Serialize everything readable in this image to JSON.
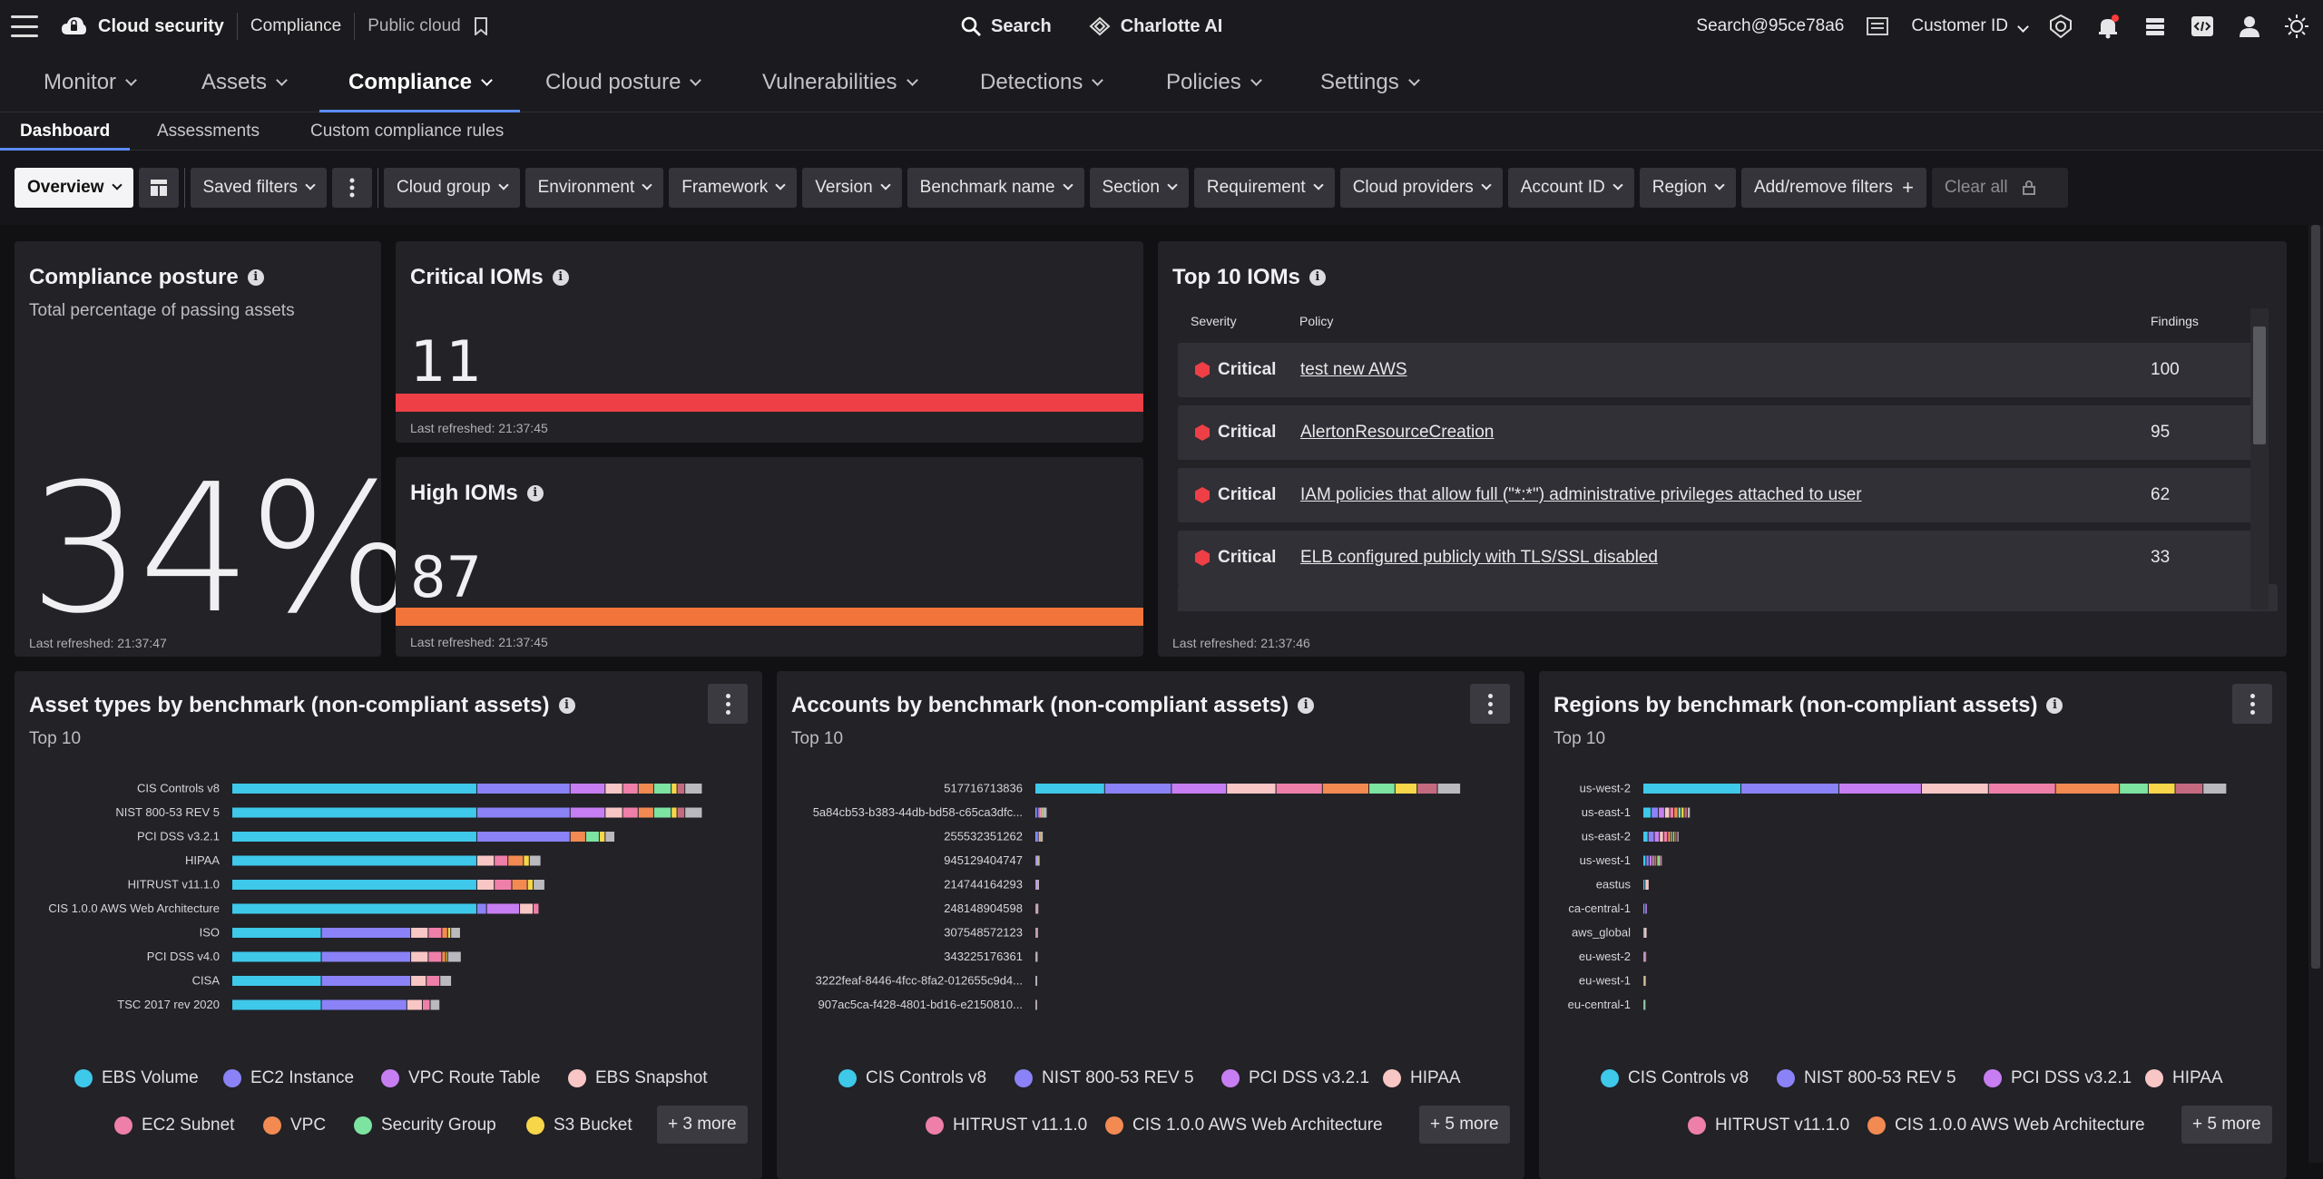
{
  "topbar": {
    "brand": "Cloud security",
    "crumbs": [
      "Compliance",
      "Public cloud"
    ],
    "search_label": "Search",
    "ai_label": "Charlotte AI",
    "user": "Search@95ce78a6",
    "customer_label": "Customer ID"
  },
  "nav": {
    "items": [
      {
        "label": "Monitor"
      },
      {
        "label": "Assets"
      },
      {
        "label": "Compliance"
      },
      {
        "label": "Cloud posture"
      },
      {
        "label": "Vulnerabilities"
      },
      {
        "label": "Detections"
      },
      {
        "label": "Policies"
      },
      {
        "label": "Settings"
      }
    ],
    "active": "Compliance"
  },
  "subnav": {
    "items": [
      {
        "label": "Dashboard"
      },
      {
        "label": "Assessments"
      },
      {
        "label": "Custom compliance rules"
      }
    ],
    "active": "Dashboard"
  },
  "filters": {
    "view": "Overview",
    "saved": "Saved filters",
    "items": [
      "Cloud group",
      "Environment",
      "Framework",
      "Version",
      "Benchmark name",
      "Section",
      "Requirement",
      "Cloud providers",
      "Account ID",
      "Region"
    ],
    "add": "Add/remove filters",
    "clear": "Clear all"
  },
  "posture": {
    "title": "Compliance posture",
    "subtitle": "Total percentage of passing assets",
    "value": "34%",
    "refreshed": "Last refreshed: 21:37:47"
  },
  "critical": {
    "title": "Critical IOMs",
    "value": "11",
    "color": "#ee3f46",
    "refreshed": "Last refreshed: 21:37:45"
  },
  "high": {
    "title": "High IOMs",
    "value": "87",
    "color": "#f2743a",
    "refreshed": "Last refreshed: 21:37:45"
  },
  "top10": {
    "title": "Top 10 IOMs",
    "headers": {
      "severity": "Severity",
      "policy": "Policy",
      "findings": "Findings"
    },
    "rows": [
      {
        "severity": "Critical",
        "policy": "test new AWS",
        "findings": "100"
      },
      {
        "severity": "Critical",
        "policy": "AlertonResourceCreation",
        "findings": "95"
      },
      {
        "severity": "Critical",
        "policy": "IAM policies that allow full (\"*:*\") administrative privileges attached to user",
        "findings": "62"
      },
      {
        "severity": "Critical",
        "policy": "ELB configured publicly with TLS/SSL disabled",
        "findings": "33"
      }
    ],
    "refreshed": "Last refreshed: 21:37:46"
  },
  "asset_chart": {
    "title": "Asset types by benchmark (non-compliant assets)",
    "subtitle": "Top 10",
    "legend": [
      "EBS Volume",
      "EC2 Instance",
      "VPC Route Table",
      "EBS Snapshot",
      "EC2 Subnet",
      "VPC",
      "Security Group",
      "S3 Bucket"
    ],
    "legend_colors": [
      "#3ec8ea",
      "#8a82f6",
      "#c77ef2",
      "#f8c6c4",
      "#ee7fa8",
      "#f28a52",
      "#7ce3a0",
      "#f7d64a"
    ],
    "more": "+ 3 more"
  },
  "accounts_chart": {
    "title": "Accounts by benchmark (non-compliant assets)",
    "subtitle": "Top 10",
    "legend": [
      "CIS Controls v8",
      "NIST 800-53 REV 5",
      "PCI DSS v3.2.1",
      "HIPAA",
      "HITRUST v11.1.0",
      "CIS 1.0.0 AWS Web Architecture"
    ],
    "legend_colors": [
      "#3ec8ea",
      "#8a82f6",
      "#c77ef2",
      "#f8c6c4",
      "#ee7fa8",
      "#f28a52"
    ],
    "more": "+ 5 more"
  },
  "regions_chart": {
    "title": "Regions by benchmark (non-compliant assets)",
    "subtitle": "Top 10",
    "legend": [
      "CIS Controls v8",
      "NIST 800-53 REV 5",
      "PCI DSS v3.2.1",
      "HIPAA",
      "HITRUST v11.1.0",
      "CIS 1.0.0 AWS Web Architecture"
    ],
    "legend_colors": [
      "#3ec8ea",
      "#8a82f6",
      "#c77ef2",
      "#f8c6c4",
      "#ee7fa8",
      "#f28a52"
    ],
    "more": "+ 5 more"
  },
  "chart_data": [
    {
      "type": "bar",
      "orientation": "horizontal",
      "stacked": true,
      "xlim": [
        0,
        13000
      ],
      "ticks": [
        0,
        1000,
        2000,
        3000,
        4000,
        5000,
        6000,
        7000,
        8000,
        9000,
        10000,
        11000,
        12000,
        13000
      ],
      "categories": [
        "CIS Controls v8",
        "NIST 800-53 REV 5",
        "PCI DSS v3.2.1",
        "HIPAA",
        "HITRUST v11.1.0",
        "CIS 1.0.0 AWS Web Architecture",
        "ISO",
        "PCI DSS v4.0",
        "CISA",
        "TSC 2017 rev 2020"
      ],
      "colors": [
        "#3ec8ea",
        "#8a82f6",
        "#c77ef2",
        "#f8c6c4",
        "#ee7fa8",
        "#f28a52",
        "#7ce3a0",
        "#f7d64a",
        "#c46a80",
        "#b9b9be"
      ],
      "series": [
        {
          "values": [
            6300,
            6300,
            6300,
            6300,
            6300,
            6300,
            2300,
            2300,
            2300,
            2300
          ]
        },
        {
          "values": [
            2400,
            2400,
            2400,
            0,
            0,
            250,
            2300,
            2300,
            2300,
            2200
          ]
        },
        {
          "values": [
            900,
            900,
            0,
            0,
            0,
            850,
            0,
            0,
            0,
            0
          ]
        },
        {
          "values": [
            450,
            450,
            0,
            450,
            450,
            350,
            450,
            450,
            400,
            400
          ]
        },
        {
          "values": [
            400,
            400,
            0,
            350,
            450,
            150,
            350,
            350,
            350,
            200
          ]
        },
        {
          "values": [
            400,
            400,
            400,
            400,
            400,
            0,
            150,
            100,
            0,
            0
          ]
        },
        {
          "values": [
            450,
            450,
            350,
            0,
            0,
            0,
            0,
            0,
            0,
            0
          ]
        },
        {
          "values": [
            150,
            150,
            150,
            150,
            150,
            0,
            80,
            50,
            0,
            0
          ]
        },
        {
          "values": [
            200,
            200,
            0,
            0,
            0,
            0,
            0,
            0,
            0,
            0
          ]
        },
        {
          "values": [
            450,
            450,
            250,
            300,
            300,
            0,
            250,
            350,
            300,
            250
          ]
        }
      ]
    },
    {
      "type": "bar",
      "orientation": "horizontal",
      "stacked": true,
      "xlim": [
        0,
        80000
      ],
      "ticks": [
        0,
        10000,
        20000,
        30000,
        40000,
        50000,
        60000,
        70000,
        80000
      ],
      "categories": [
        "517716713836",
        "5a84cb53-b383-44db-bd58-c65ca3dfc...",
        "255532351262",
        "945129404747",
        "214744164293",
        "248148904598",
        "307548572123",
        "343225176361",
        "3222feaf-8446-4fcc-8fa2-012655c9d4...",
        "907ac5ca-f428-4801-bd16-e2150810..."
      ],
      "colors": [
        "#3ec8ea",
        "#8a82f6",
        "#c77ef2",
        "#f8c6c4",
        "#ee7fa8",
        "#f28a52",
        "#7ce3a0",
        "#f7d64a",
        "#c46a80",
        "#b9b9be"
      ],
      "series": [
        {
          "values": [
            12000,
            200,
            150,
            100,
            80,
            60,
            50,
            40,
            30,
            20
          ]
        },
        {
          "values": [
            11500,
            300,
            200,
            100,
            80,
            60,
            50,
            40,
            30,
            20
          ]
        },
        {
          "values": [
            9500,
            200,
            250,
            80,
            80,
            60,
            50,
            40,
            30,
            20
          ]
        },
        {
          "values": [
            8500,
            150,
            100,
            80,
            60,
            40,
            30,
            20,
            20,
            10
          ]
        },
        {
          "values": [
            8000,
            150,
            100,
            60,
            50,
            40,
            30,
            20,
            10,
            10
          ]
        },
        {
          "values": [
            8000,
            100,
            80,
            50,
            40,
            30,
            20,
            20,
            10,
            10
          ]
        },
        {
          "values": [
            4500,
            80,
            60,
            40,
            30,
            20,
            20,
            10,
            10,
            10
          ]
        },
        {
          "values": [
            3800,
            60,
            50,
            30,
            20,
            20,
            10,
            10,
            10,
            10
          ]
        },
        {
          "values": [
            3500,
            60,
            40,
            30,
            20,
            20,
            10,
            10,
            10,
            10
          ]
        },
        {
          "values": [
            4000,
            800,
            400,
            100,
            80,
            60,
            40,
            30,
            20,
            10
          ]
        }
      ]
    },
    {
      "type": "bar",
      "orientation": "horizontal",
      "stacked": true,
      "xlim": [
        0,
        60000
      ],
      "ticks": [
        0,
        5000,
        10000,
        15000,
        20000,
        25000,
        30000,
        35000,
        40000,
        45000,
        50000,
        55000,
        60000
      ],
      "categories": [
        "us-west-2",
        "us-east-1",
        "us-east-2",
        "us-west-1",
        "eastus",
        "ca-central-1",
        "aws_global",
        "eu-west-2",
        "eu-west-1",
        "eu-central-1"
      ],
      "colors": [
        "#3ec8ea",
        "#8a82f6",
        "#c77ef2",
        "#f8c6c4",
        "#ee7fa8",
        "#f28a52",
        "#7ce3a0",
        "#f7d64a",
        "#c46a80",
        "#b9b9be"
      ],
      "series": [
        {
          "values": [
            9500,
            800,
            500,
            300,
            200,
            150,
            100,
            50,
            40,
            30
          ]
        },
        {
          "values": [
            9500,
            700,
            600,
            300,
            0,
            100,
            0,
            40,
            30,
            30
          ]
        },
        {
          "values": [
            8000,
            600,
            500,
            300,
            0,
            50,
            0,
            30,
            20,
            20
          ]
        },
        {
          "values": [
            6500,
            500,
            400,
            200,
            400,
            0,
            300,
            20,
            20,
            10
          ]
        },
        {
          "values": [
            6500,
            400,
            400,
            200,
            0,
            0,
            0,
            20,
            10,
            10
          ]
        },
        {
          "values": [
            6200,
            400,
            300,
            100,
            0,
            0,
            0,
            10,
            10,
            10
          ]
        },
        {
          "values": [
            2800,
            300,
            200,
            100,
            0,
            0,
            0,
            10,
            10,
            10
          ]
        },
        {
          "values": [
            2600,
            300,
            200,
            100,
            0,
            0,
            0,
            10,
            10,
            0
          ]
        },
        {
          "values": [
            2700,
            300,
            200,
            100,
            0,
            0,
            0,
            10,
            0,
            0
          ]
        },
        {
          "values": [
            2300,
            300,
            200,
            100,
            0,
            0,
            0,
            0,
            0,
            0
          ]
        }
      ]
    }
  ]
}
